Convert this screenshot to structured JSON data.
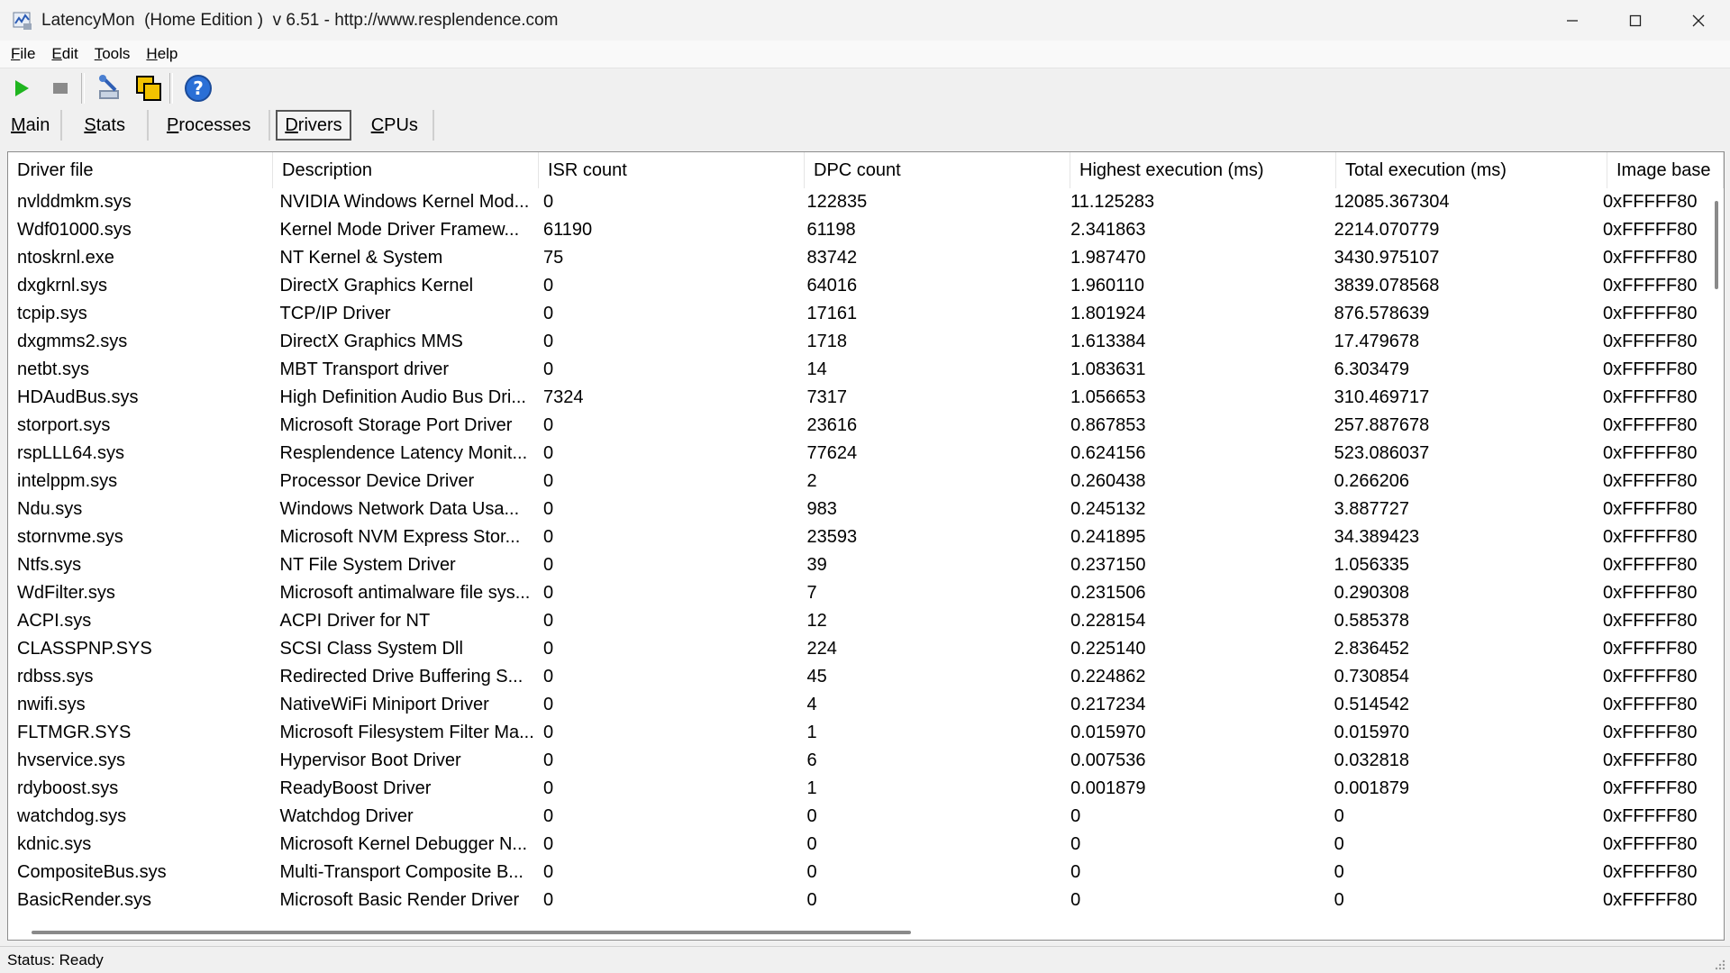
{
  "window": {
    "title": "LatencyMon  (Home Edition )  v 6.51 - http://www.resplendence.com",
    "controls": {
      "minimize": "—",
      "maximize": "☐",
      "close": "✕"
    }
  },
  "menu": [
    {
      "accel": "F",
      "rest": "ile"
    },
    {
      "accel": "E",
      "rest": "dit"
    },
    {
      "accel": "T",
      "rest": "ools"
    },
    {
      "accel": "H",
      "rest": "elp"
    }
  ],
  "toolbar": {
    "icons": [
      "play-icon",
      "stop-icon",
      "tools-icon",
      "copy-window-icon",
      "help-icon"
    ],
    "colors": {
      "play": "#1fb51f",
      "stop": "#8a8a8a",
      "help": "#2a6fd6"
    }
  },
  "tabs": [
    {
      "accel": "M",
      "rest": "ain",
      "active": false
    },
    {
      "accel": "S",
      "rest": "tats",
      "active": false
    },
    {
      "accel": "P",
      "rest": "rocesses",
      "active": false
    },
    {
      "accel": "D",
      "rest": "rivers",
      "active": true
    },
    {
      "accel": "C",
      "rest": "PUs",
      "active": false
    }
  ],
  "table": {
    "columns": [
      "Driver file",
      "Description",
      "ISR count",
      "DPC count",
      "Highest execution (ms)",
      "Total execution (ms)",
      "Image base"
    ],
    "rows": [
      [
        "nvlddmkm.sys",
        "NVIDIA Windows Kernel Mod...",
        "0",
        "122835",
        "11.125283",
        "12085.367304",
        "0xFFFFF80"
      ],
      [
        "Wdf01000.sys",
        "Kernel Mode Driver Framew...",
        "61190",
        "61198",
        "2.341863",
        "2214.070779",
        "0xFFFFF80"
      ],
      [
        "ntoskrnl.exe",
        "NT Kernel & System",
        "75",
        "83742",
        "1.987470",
        "3430.975107",
        "0xFFFFF80"
      ],
      [
        "dxgkrnl.sys",
        "DirectX Graphics Kernel",
        "0",
        "64016",
        "1.960110",
        "3839.078568",
        "0xFFFFF80"
      ],
      [
        "tcpip.sys",
        "TCP/IP Driver",
        "0",
        "17161",
        "1.801924",
        "876.578639",
        "0xFFFFF80"
      ],
      [
        "dxgmms2.sys",
        "DirectX Graphics MMS",
        "0",
        "1718",
        "1.613384",
        "17.479678",
        "0xFFFFF80"
      ],
      [
        "netbt.sys",
        "MBT Transport driver",
        "0",
        "14",
        "1.083631",
        "6.303479",
        "0xFFFFF80"
      ],
      [
        "HDAudBus.sys",
        "High Definition Audio Bus Dri...",
        "7324",
        "7317",
        "1.056653",
        "310.469717",
        "0xFFFFF80"
      ],
      [
        "storport.sys",
        "Microsoft Storage Port Driver",
        "0",
        "23616",
        "0.867853",
        "257.887678",
        "0xFFFFF80"
      ],
      [
        "rspLLL64.sys",
        "Resplendence Latency Monit...",
        "0",
        "77624",
        "0.624156",
        "523.086037",
        "0xFFFFF80"
      ],
      [
        "intelppm.sys",
        "Processor Device Driver",
        "0",
        "2",
        "0.260438",
        "0.266206",
        "0xFFFFF80"
      ],
      [
        "Ndu.sys",
        "Windows Network Data Usa...",
        "0",
        "983",
        "0.245132",
        "3.887727",
        "0xFFFFF80"
      ],
      [
        "stornvme.sys",
        "Microsoft NVM Express Stor...",
        "0",
        "23593",
        "0.241895",
        "34.389423",
        "0xFFFFF80"
      ],
      [
        "Ntfs.sys",
        "NT File System Driver",
        "0",
        "39",
        "0.237150",
        "1.056335",
        "0xFFFFF80"
      ],
      [
        "WdFilter.sys",
        "Microsoft antimalware file sys...",
        "0",
        "7",
        "0.231506",
        "0.290308",
        "0xFFFFF80"
      ],
      [
        "ACPI.sys",
        "ACPI Driver for NT",
        "0",
        "12",
        "0.228154",
        "0.585378",
        "0xFFFFF80"
      ],
      [
        "CLASSPNP.SYS",
        "SCSI Class System Dll",
        "0",
        "224",
        "0.225140",
        "2.836452",
        "0xFFFFF80"
      ],
      [
        "rdbss.sys",
        "Redirected Drive Buffering S...",
        "0",
        "45",
        "0.224862",
        "0.730854",
        "0xFFFFF80"
      ],
      [
        "nwifi.sys",
        "NativeWiFi Miniport Driver",
        "0",
        "4",
        "0.217234",
        "0.514542",
        "0xFFFFF80"
      ],
      [
        "FLTMGR.SYS",
        "Microsoft Filesystem Filter Ma...",
        "0",
        "1",
        "0.015970",
        "0.015970",
        "0xFFFFF80"
      ],
      [
        "hvservice.sys",
        "Hypervisor Boot Driver",
        "0",
        "6",
        "0.007536",
        "0.032818",
        "0xFFFFF80"
      ],
      [
        "rdyboost.sys",
        "ReadyBoost Driver",
        "0",
        "1",
        "0.001879",
        "0.001879",
        "0xFFFFF80"
      ],
      [
        "watchdog.sys",
        "Watchdog Driver",
        "0",
        "0",
        "0",
        "0",
        "0xFFFFF80"
      ],
      [
        "kdnic.sys",
        "Microsoft Kernel Debugger N...",
        "0",
        "0",
        "0",
        "0",
        "0xFFFFF80"
      ],
      [
        "CompositeBus.sys",
        "Multi-Transport Composite B...",
        "0",
        "0",
        "0",
        "0",
        "0xFFFFF80"
      ],
      [
        "BasicRender.sys",
        "Microsoft Basic Render Driver",
        "0",
        "0",
        "0",
        "0",
        "0xFFFFF80"
      ]
    ]
  },
  "status": {
    "text": "Status: Ready"
  }
}
